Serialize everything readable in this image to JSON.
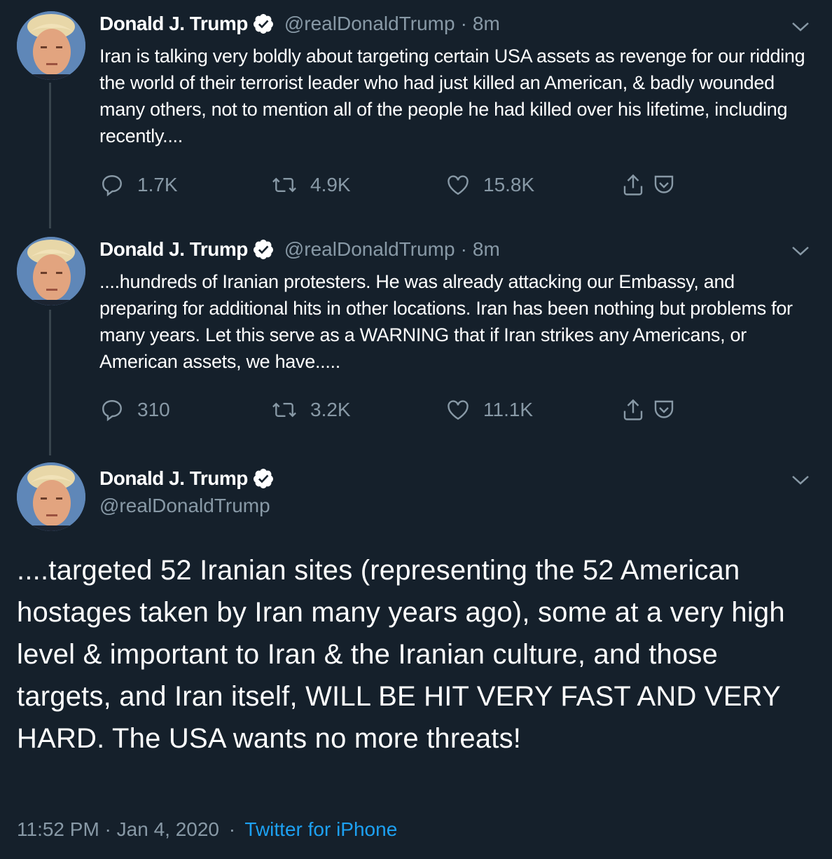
{
  "tweets": [
    {
      "name": "Donald J. Trump",
      "handle": "@realDonaldTrump",
      "separator": "·",
      "time": "8m",
      "text": "Iran is talking very boldly about targeting certain USA assets as revenge for our ridding the world of their terrorist leader who had just killed an American, & badly wounded many others, not to mention all of the people he had killed over his lifetime, including recently....",
      "replies": "1.7K",
      "retweets": "4.9K",
      "likes": "15.8K"
    },
    {
      "name": "Donald J. Trump",
      "handle": "@realDonaldTrump",
      "separator": "·",
      "time": "8m",
      "text": "....hundreds of Iranian protesters. He was already attacking our Embassy, and preparing for additional hits in other locations. Iran has been nothing but problems for many years. Let this serve as a WARNING that if Iran strikes any Americans, or American assets, we have.....",
      "replies": "310",
      "retweets": "3.2K",
      "likes": "11.1K"
    }
  ],
  "main_tweet": {
    "name": "Donald J. Trump",
    "handle": "@realDonaldTrump",
    "text": "....targeted 52 Iranian sites (representing the 52 American hostages taken by Iran many years ago), some at a very high level & important to Iran &  the Iranian culture, and those targets, and Iran itself, WILL BE HIT VERY FAST AND VERY HARD. The USA wants no more threats!",
    "timestamp": "11:52 PM · Jan 4, 2020",
    "separator": "·",
    "source": "Twitter for iPhone"
  },
  "icons": {
    "verified": "verified-badge-icon",
    "chevron": "chevron-down-icon",
    "reply": "reply-icon",
    "retweet": "retweet-icon",
    "like": "heart-icon",
    "share": "share-icon",
    "save": "pocket-icon"
  },
  "colors": {
    "background": "#15202b",
    "text": "#ffffff",
    "secondary": "#8899a6",
    "link": "#1da1f2",
    "thread_line": "#38444d"
  }
}
